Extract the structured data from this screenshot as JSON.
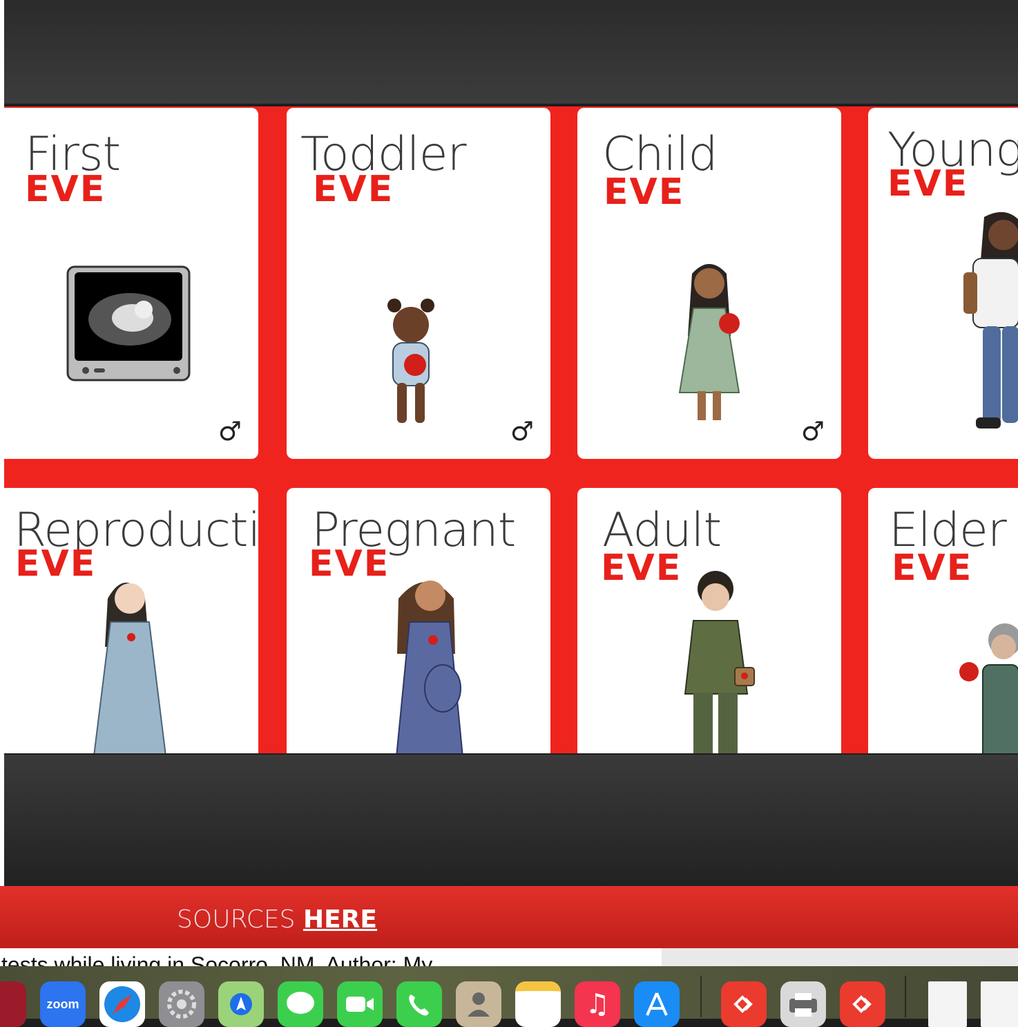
{
  "cards": [
    {
      "title": "First",
      "label": "EVE",
      "symbol": "♂"
    },
    {
      "title": "Toddler",
      "label": "EVE",
      "symbol": "♂"
    },
    {
      "title": "Child",
      "label": "EVE",
      "symbol": "♂"
    },
    {
      "title": "Young A",
      "label": "EVE"
    },
    {
      "title": "Reproductive",
      "label": "EVE"
    },
    {
      "title": "Pregnant",
      "label": "EVE"
    },
    {
      "title": "Adult",
      "label": "EVE"
    },
    {
      "title": "Elder",
      "label": "EVE"
    }
  ],
  "sources": {
    "prefix": "SOURCES",
    "link": "HERE"
  },
  "document": {
    "snippet": "tests while living in Socorro, NM.  Author: My"
  },
  "dock": [
    {
      "name": "red-app-icon",
      "label": ""
    },
    {
      "name": "zoom-icon",
      "label": "zoom"
    },
    {
      "name": "safari-icon",
      "label": ""
    },
    {
      "name": "system-settings-icon",
      "label": ""
    },
    {
      "name": "maps-icon",
      "label": ""
    },
    {
      "name": "messages-icon",
      "label": ""
    },
    {
      "name": "facetime-icon",
      "label": ""
    },
    {
      "name": "phone-icon",
      "label": ""
    },
    {
      "name": "contacts-icon",
      "label": ""
    },
    {
      "name": "notes-icon",
      "label": ""
    },
    {
      "name": "music-icon",
      "label": ""
    },
    {
      "name": "app-store-icon",
      "label": ""
    },
    {
      "name": "anydesk-icon",
      "label": ""
    },
    {
      "name": "printer-icon",
      "label": ""
    },
    {
      "name": "anydesk-icon-2",
      "label": ""
    },
    {
      "name": "document-thumbnail-icon",
      "label": ""
    },
    {
      "name": "document-thumbnail-icon-2",
      "label": ""
    }
  ],
  "colors": {
    "accent": "#f0241e",
    "eve": "#e8201a",
    "dock": "#5a5e40"
  }
}
